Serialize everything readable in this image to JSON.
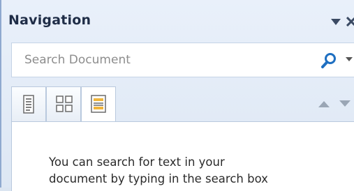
{
  "pane": {
    "title": "Navigation",
    "menu_icon": "dropdown-triangle-icon",
    "close_icon": "close-icon"
  },
  "search": {
    "placeholder": "Search Document",
    "icon": "magnifier-icon"
  },
  "tabs": [
    {
      "name": "browse-headings",
      "icon": "headings-icon",
      "active": false
    },
    {
      "name": "browse-pages",
      "icon": "pages-thumbnail-icon",
      "active": false
    },
    {
      "name": "browse-results",
      "icon": "results-list-icon",
      "active": true
    }
  ],
  "content": {
    "line1": "You can search for text in your",
    "line2": "document by typing in the search box"
  },
  "colors": {
    "accent": "#1e6fc1",
    "border": "#8fa9cf"
  }
}
